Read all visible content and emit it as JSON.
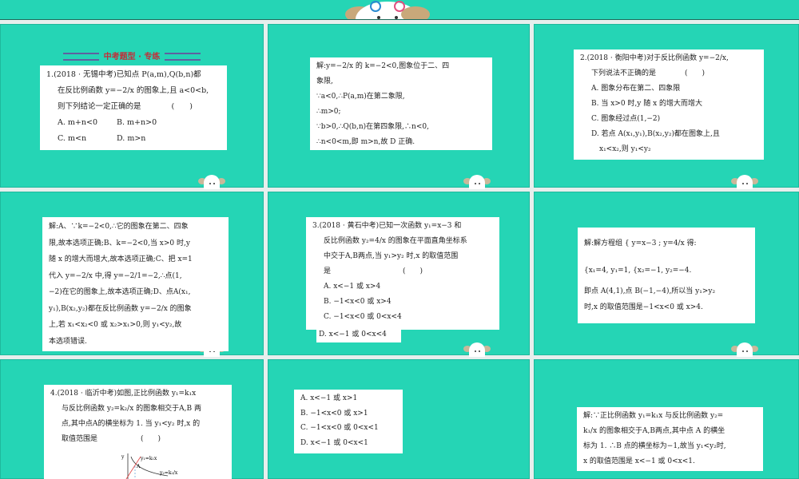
{
  "slides": [
    {
      "title": "中考题型 · 专练",
      "lines": [
        "1.(2018 · 无锡中考)已知点 P(a,m),Q(b,n)都",
        "在反比例函数 y=−2/x 的图象上,且 a<0<b,",
        "则下列结论一定正确的是　　　　(　　)"
      ],
      "options": [
        "A. m+n<0",
        "B. m+n>0",
        "C. m<n",
        "D. m>n"
      ]
    },
    {
      "lines": [
        "解:y=−2/x 的 k=−2<0,图象位于二、四",
        "象限,",
        "∵a<0,∴P(a,m)在第二象限,",
        "∴m>0;",
        "∵b>0,∴Q(b,n)在第四象限,∴n<0,",
        "∴n<0<m,即 m>n,故 D 正确."
      ]
    },
    {
      "lines": [
        "2.(2018 · 衡阳中考)对于反比例函数 y=−2/x,",
        "下列说法不正确的是　　　　(　　)",
        "A. 图象分布在第二、四象限",
        "B. 当 x>0 时,y 随 x 的增大而增大",
        "C. 图象经过点(1,−2)",
        "D. 若点 A(x₁,y₁),B(x₂,y₂)都在图象上,且",
        "x₁<x₂,则 y₁<y₂"
      ]
    },
    {
      "lines": [
        "解:A、∵k=−2<0,∴它的图象在第二、四象",
        "限,故本选项正确;B、k=−2<0,当 x>0 时,y",
        "随 x 的增大而增大,故本选项正确;C、把 x=1",
        "代入 y=−2/x 中,得 y=−2/1=−2,∴点(1,",
        "−2)在它的图象上,故本选项正确;D、点A(x₁,",
        "y₁),B(x₂,y₂)都在反比例函数 y=−2/x 的图象",
        "上,若 x₁<x₂<0 或 x₂>x₁>0,则 y₁<y₂,故",
        "本选项错误."
      ]
    },
    {
      "lines": [
        "3.(2018 · 黄石中考)已知一次函数 y₁=x−3 和",
        "反比例函数 y₂=4/x 的图象在平面直角坐标系",
        "中交于A,B两点,当 y₁>y₂ 时,x 的取值范围",
        "是　　　　　　　　　　(　　)",
        "A. x<−1 或 x>4",
        "B. −1<x<0 或 x>4",
        "C. −1<x<0 或 0<x<4"
      ],
      "last": "D. x<−1 或 0<x<4"
    },
    {
      "lines": [
        "解:解方程组 { y=x−3 ; y=4/x 得:",
        "{x₁=4, y₁=1,  {x₂=−1, y₂=−4.",
        "即点 A(4,1),点 B(−1,−4),所以当 y₁>y₂",
        "时,x 的取值范围是−1<x<0 或 x>4."
      ]
    },
    {
      "lines": [
        "4.(2018 · 临沂中考)如图,正比例函数 y₁=k₁x",
        "与反比例函数 y₂=k₂/x 的图象相交于A,B 两",
        "点,其中点A的横坐标为 1. 当 y₁<y₂ 时,x 的",
        "取值范围是　　　　　　(　　)"
      ],
      "graph_labels": [
        "y",
        "y₁=k₁x",
        "A",
        "y₂=k₂/x"
      ]
    },
    {
      "lines": [
        "A. x<−1 或 x>1",
        "B. −1<x<0 或 x>1",
        "C. −1<x<0 或 0<x<1",
        "D. x<−1 或 0<x<1"
      ]
    },
    {
      "lines": [
        "解:∵正比例函数 y₁=k₁x 与反比例函数 y₂=",
        "k₁/x 的图象相交于A,B两点,其中点 A 的横坐",
        "标为 1. ∴B 点的横坐标为−1,故当 y₁<y₂时,",
        "x 的取值范围是 x<−1 或 0<x<1."
      ]
    }
  ],
  "colors": {
    "panel": "#25d5b5",
    "gap": "#e6efed",
    "title": "#c0303a"
  }
}
